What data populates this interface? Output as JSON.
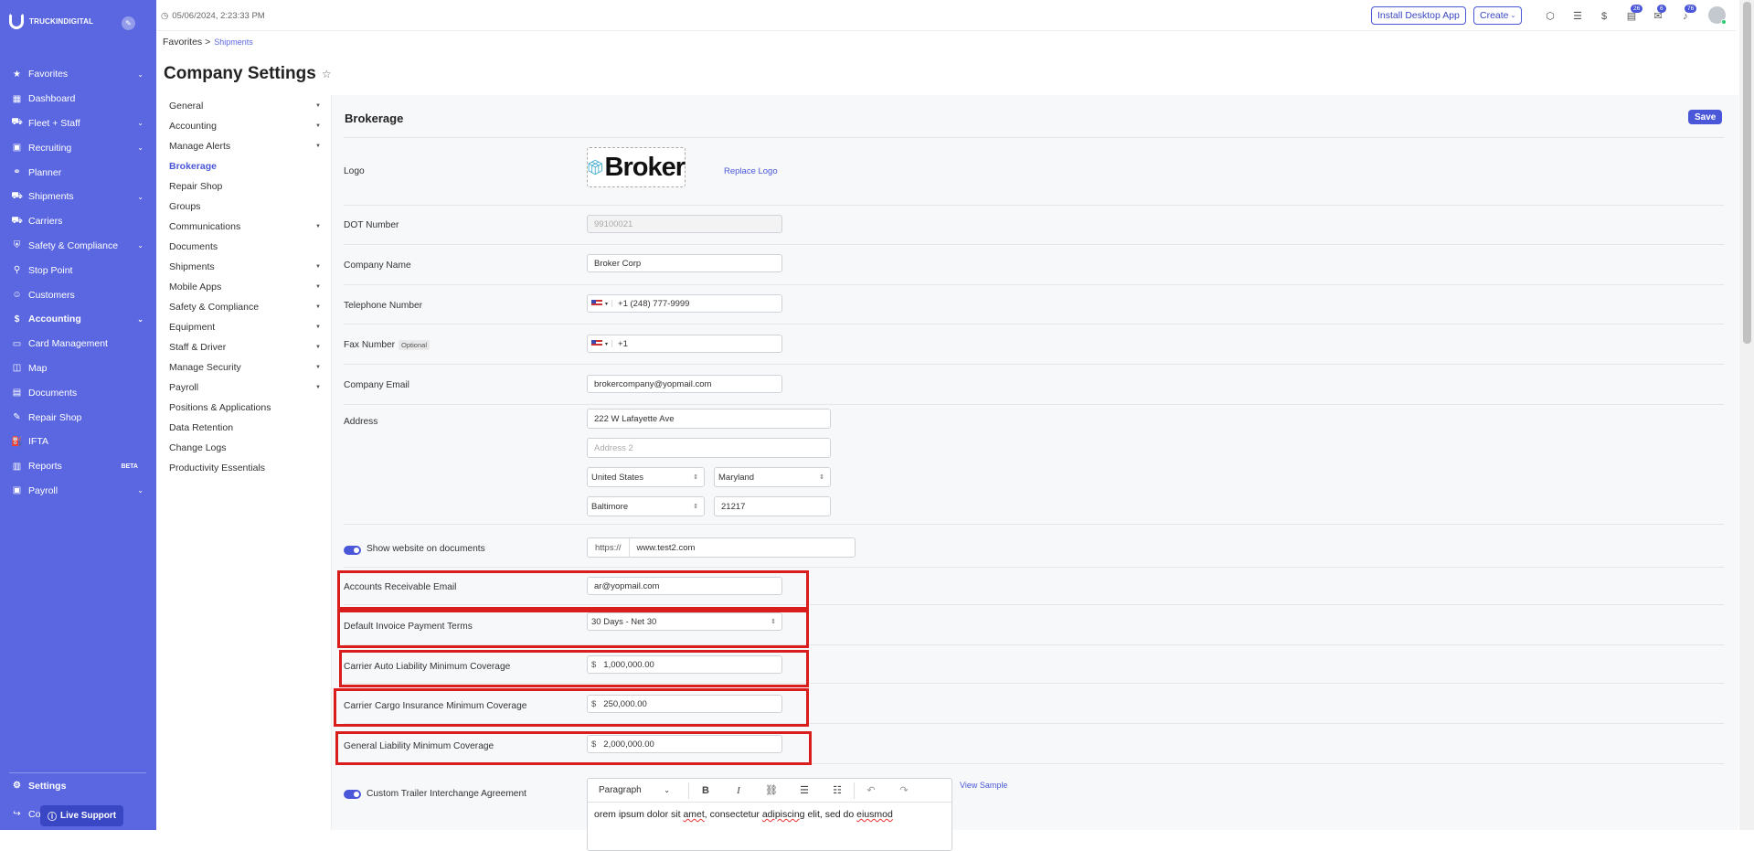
{
  "app": {
    "brand": "TRUCKINDIGITAL"
  },
  "sidebar": {
    "items": [
      {
        "label": "Favorites",
        "icon": "star-icon",
        "glyph": "★",
        "chevron": true,
        "bold": false
      },
      {
        "label": "Dashboard",
        "icon": "dashboard-icon",
        "glyph": "▦",
        "chevron": false,
        "bold": false
      },
      {
        "label": "Fleet + Staff",
        "icon": "truck-icon",
        "glyph": "⛟",
        "chevron": true,
        "bold": false
      },
      {
        "label": "Recruiting",
        "icon": "briefcase-icon",
        "glyph": "▣",
        "chevron": true,
        "bold": false
      },
      {
        "label": "Planner",
        "icon": "planner-icon",
        "glyph": "⚭",
        "chevron": false,
        "bold": false
      },
      {
        "label": "Shipments",
        "icon": "shipment-truck-icon",
        "glyph": "⛟",
        "chevron": true,
        "bold": false
      },
      {
        "label": "Carriers",
        "icon": "carrier-icon",
        "glyph": "⛟",
        "chevron": false,
        "bold": false
      },
      {
        "label": "Safety & Compliance",
        "icon": "shield-icon",
        "glyph": "⛨",
        "chevron": true,
        "bold": false
      },
      {
        "label": "Stop Point",
        "icon": "map-pin-icon",
        "glyph": "⚲",
        "chevron": false,
        "bold": false
      },
      {
        "label": "Customers",
        "icon": "users-icon",
        "glyph": "☺",
        "chevron": false,
        "bold": false
      },
      {
        "label": "Accounting",
        "icon": "dollar-icon",
        "glyph": "$",
        "chevron": true,
        "bold": true
      },
      {
        "label": "Card Management",
        "icon": "credit-card-icon",
        "glyph": "▭",
        "chevron": false,
        "bold": false
      },
      {
        "label": "Map",
        "icon": "map-icon",
        "glyph": "◫",
        "chevron": false,
        "bold": false
      },
      {
        "label": "Documents",
        "icon": "document-icon",
        "glyph": "▤",
        "chevron": false,
        "bold": false
      },
      {
        "label": "Repair Shop",
        "icon": "wrench-icon",
        "glyph": "✎",
        "chevron": false,
        "bold": false
      },
      {
        "label": "IFTA",
        "icon": "fuel-icon",
        "glyph": "⛽",
        "chevron": false,
        "bold": false
      },
      {
        "label": "Reports",
        "icon": "reports-icon",
        "glyph": "▥",
        "chevron": false,
        "bold": false,
        "badge": "BETA"
      },
      {
        "label": "Payroll",
        "icon": "payroll-icon",
        "glyph": "▣",
        "chevron": true,
        "bold": false
      }
    ],
    "settings_label": "Settings",
    "co_label": "Co",
    "live_support": "Live Support"
  },
  "topbar": {
    "timestamp": "05/06/2024, 2:23:33 PM",
    "install_label": "Install Desktop App",
    "create_label": "Create",
    "badges": {
      "tasks": "26",
      "messages": "6",
      "notifications": "76"
    }
  },
  "breadcrumb": {
    "root": "Favorites >",
    "current": "Shipments"
  },
  "page": {
    "title": "Company Settings"
  },
  "subnav": {
    "items": [
      {
        "label": "General",
        "caret": true,
        "active": false
      },
      {
        "label": "Accounting",
        "caret": true,
        "active": false
      },
      {
        "label": "Manage Alerts",
        "caret": true,
        "active": false
      },
      {
        "label": "Brokerage",
        "caret": false,
        "active": true
      },
      {
        "label": "Repair Shop",
        "caret": false,
        "active": false
      },
      {
        "label": "Groups",
        "caret": false,
        "active": false
      },
      {
        "label": "Communications",
        "caret": true,
        "active": false
      },
      {
        "label": "Documents",
        "caret": false,
        "active": false
      },
      {
        "label": "Shipments",
        "caret": true,
        "active": false
      },
      {
        "label": "Mobile Apps",
        "caret": true,
        "active": false
      },
      {
        "label": "Safety & Compliance",
        "caret": true,
        "active": false
      },
      {
        "label": "Equipment",
        "caret": true,
        "active": false
      },
      {
        "label": "Staff & Driver",
        "caret": true,
        "active": false
      },
      {
        "label": "Manage Security",
        "caret": true,
        "active": false
      },
      {
        "label": "Payroll",
        "caret": true,
        "active": false
      },
      {
        "label": "Positions & Applications",
        "caret": false,
        "active": false
      },
      {
        "label": "Data Retention",
        "caret": false,
        "active": false
      },
      {
        "label": "Change Logs",
        "caret": false,
        "active": false
      },
      {
        "label": "Productivity Essentials",
        "caret": false,
        "active": false
      }
    ]
  },
  "brokerage": {
    "title": "Brokerage",
    "save_label": "Save",
    "logo_label": "Logo",
    "logo_text": "Broker",
    "replace_logo": "Replace Logo",
    "dot_label": "DOT Number",
    "dot_value": "99100021",
    "company_name_label": "Company Name",
    "company_name_value": "Broker Corp",
    "telephone_label": "Telephone Number",
    "telephone_value": "+1 (248) 777-9999",
    "fax_label": "Fax Number",
    "optional_label": "Optional",
    "fax_value": "+1",
    "email_label": "Company Email",
    "email_value": "brokercompany@yopmail.com",
    "address_label": "Address",
    "address1": "222 W Lafayette Ave",
    "address2_placeholder": "Address 2",
    "country": "United States",
    "state": "Maryland",
    "city": "Baltimore",
    "zip": "21217",
    "show_website_label": "Show website on documents",
    "website_prefix": "https://",
    "website_value": "www.test2.com",
    "ar_email_label": "Accounts Receivable Email",
    "ar_email_value": "ar@yopmail.com",
    "payment_terms_label": "Default Invoice Payment Terms",
    "payment_terms_value": "30 Days - Net 30",
    "auto_liability_label": "Carrier Auto Liability Minimum Coverage",
    "auto_liability_value": "1,000,000.00",
    "cargo_label": "Carrier Cargo Insurance Minimum Coverage",
    "cargo_value": "250,000.00",
    "general_liability_label": "General Liability Minimum Coverage",
    "general_liability_value": "2,000,000.00",
    "currency_symbol": "$",
    "trailer_label": "Custom Trailer Interchange Agreement",
    "view_sample": "View Sample",
    "editor_style": "Paragraph",
    "editor_text_prefix": "orem ipsum dolor sit ",
    "editor_text_amet": "amet",
    "editor_text_mid": ", consectetur ",
    "editor_text_adip": "adipiscing",
    "editor_text_mid2": " elit, sed do ",
    "editor_text_eius": "eiusmod"
  },
  "colors": {
    "sidebar": "#5a67e0",
    "accent": "#4a57d8",
    "highlight": "#d91c1c"
  }
}
